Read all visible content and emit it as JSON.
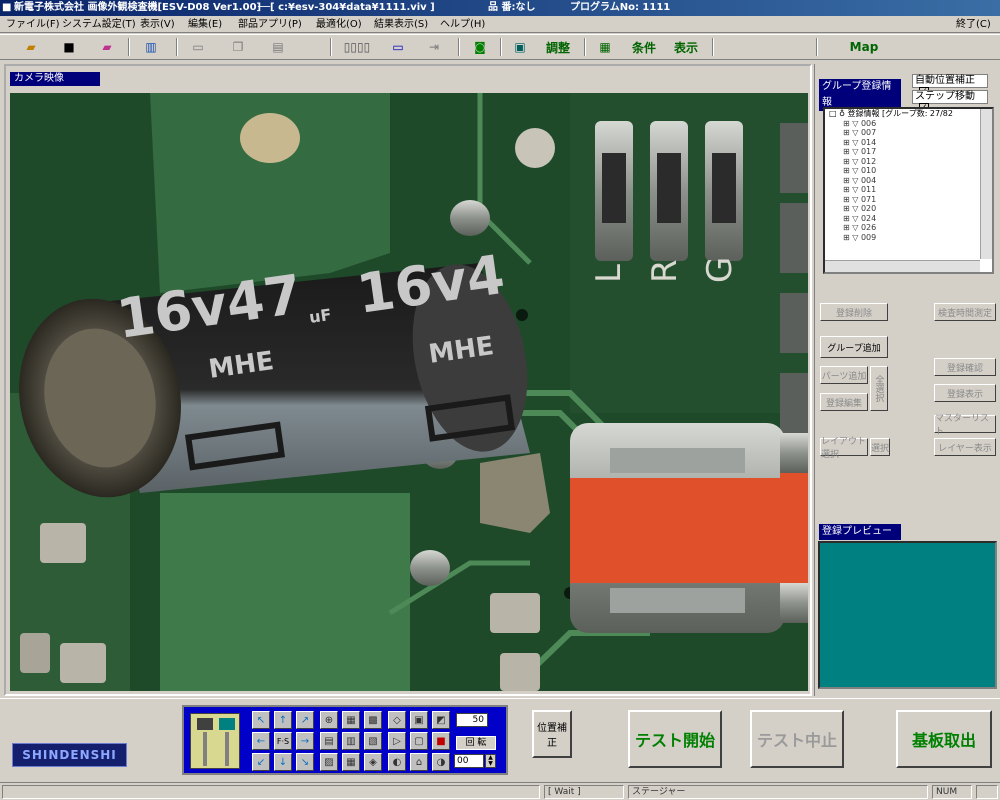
{
  "title": {
    "app": "新電子株式会社 画像外観検査機[ESV-D08 Ver1.00]",
    "file": "──[ c:¥esv-304¥data¥1111.viv ]",
    "part": "品 番:なし",
    "program": "プログラムNo: 1111"
  },
  "menu": {
    "items": [
      "ファイル(F)",
      "システム設定(T)",
      "表示(V)",
      "編集(E)",
      "部品アプリ(P)",
      "最適化(O)",
      "結果表示(S)",
      "ヘルプ(H)"
    ],
    "exit": "終了(C)"
  },
  "toolbar": {
    "adjust": "調整",
    "conditions": "条件",
    "display": "表示",
    "map": "Map"
  },
  "camera": {
    "label": "カメラ映像",
    "capacitor_text_1": "16v47",
    "capacitor_unit_1": "uF",
    "capacitor_model_1": "MHE",
    "capacitor_text_2": "16v4",
    "capacitor_model_2": "MHE",
    "silk_l": "L",
    "silk_r": "R",
    "silk_g": "G"
  },
  "right_panel": {
    "group_info_label": "グループ登録情報",
    "auto_position": "自動位置補正",
    "step_move": "ステップ移動",
    "tree_header": "登録情報 [グループ数: 27/82",
    "tree_items": [
      "006",
      "007",
      "014",
      "017",
      "012",
      "010",
      "004",
      "011",
      "071",
      "020",
      "024",
      "026",
      "009"
    ],
    "buttons": {
      "delete_registration": "登録削除",
      "inspection_time": "検査時間測定",
      "group_add": "グループ追加",
      "parts_add": "パーツ追加",
      "register_edit": "登録編集",
      "select_all": "全選択",
      "register_confirm": "登録確認",
      "register_display": "登録表示",
      "master_list": "マスターリスト",
      "layout_select": "レイアウト選択",
      "select": "選択",
      "layer_display": "レイヤー表示"
    },
    "preview_label": "登録プレビュー"
  },
  "bottom": {
    "logo": "SHINDENSHI",
    "speed_value": "50",
    "rotate_label": "回 転",
    "rotate_value": "00",
    "position_correct": "位置補正",
    "test_start": "テスト開始",
    "test_stop": "テスト中止",
    "board_eject": "基板取出"
  },
  "status": {
    "wait": "[ Wait ]",
    "stage": "ステージャー",
    "num": "NUM"
  }
}
